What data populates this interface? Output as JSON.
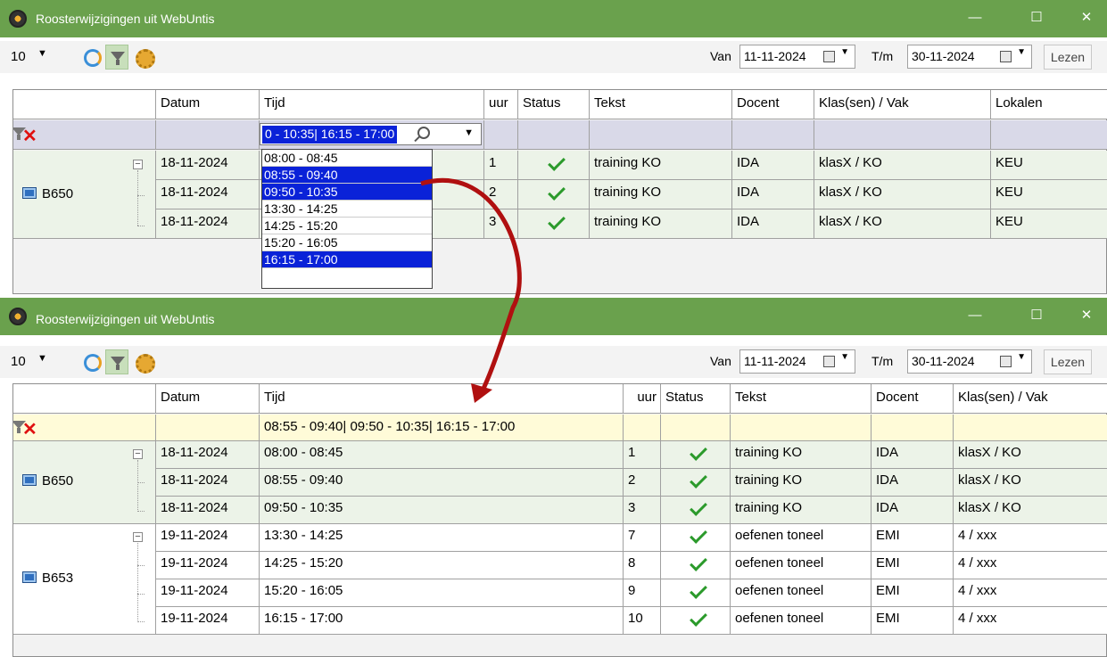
{
  "windows": [
    {
      "title": "Roosterwijzigingen uit WebUntis",
      "toolbar": {
        "count": "10",
        "van_label": "Van",
        "van_date": "11-11-2024",
        "tm_label": "T/m",
        "tm_date": "30-11-2024",
        "lezen": "Lezen"
      },
      "columns": [
        "Datum",
        "Tijd",
        "uur",
        "Status",
        "Tekst",
        "Docent",
        "Klas(sen) / Vak",
        "Lokalen"
      ],
      "filter_text": "0 - 10:35| 16:15 - 17:00",
      "dropdown_items": [
        {
          "label": "08:00 - 08:45",
          "selected": false
        },
        {
          "label": "08:55 - 09:40",
          "selected": true
        },
        {
          "label": "09:50 - 10:35",
          "selected": true
        },
        {
          "label": "13:30 - 14:25",
          "selected": false
        },
        {
          "label": "14:25 - 15:20",
          "selected": false
        },
        {
          "label": "15:20 - 16:05",
          "selected": false
        },
        {
          "label": "16:15 - 17:00",
          "selected": true
        }
      ],
      "group": "B650",
      "rows": [
        {
          "datum": "18-11-2024",
          "uur": "1",
          "tekst": "training KO",
          "docent": "IDA",
          "klas": "klasX / KO",
          "lokaal": "KEU"
        },
        {
          "datum": "18-11-2024",
          "uur": "2",
          "tekst": "training KO",
          "docent": "IDA",
          "klas": "klasX / KO",
          "lokaal": "KEU"
        },
        {
          "datum": "18-11-2024",
          "uur": "3",
          "tekst": "training KO",
          "docent": "IDA",
          "klas": "klasX / KO",
          "lokaal": "KEU"
        }
      ]
    },
    {
      "title": "Roosterwijzigingen uit WebUntis",
      "toolbar": {
        "count": "10",
        "van_label": "Van",
        "van_date": "11-11-2024",
        "tm_label": "T/m",
        "tm_date": "30-11-2024",
        "lezen": "Lezen"
      },
      "columns": [
        "Datum",
        "Tijd",
        "uur",
        "Status",
        "Tekst",
        "Docent",
        "Klas(sen) / Vak"
      ],
      "filter_text": "08:55 - 09:40| 09:50 - 10:35| 16:15 - 17:00",
      "groups": [
        {
          "name": "B650",
          "rows": [
            {
              "datum": "18-11-2024",
              "tijd": "08:00 - 08:45",
              "uur": "1",
              "tekst": "training KO",
              "docent": "IDA",
              "klas": "klasX / KO"
            },
            {
              "datum": "18-11-2024",
              "tijd": "08:55 - 09:40",
              "uur": "2",
              "tekst": "training KO",
              "docent": "IDA",
              "klas": "klasX / KO"
            },
            {
              "datum": "18-11-2024",
              "tijd": "09:50 - 10:35",
              "uur": "3",
              "tekst": "training KO",
              "docent": "IDA",
              "klas": "klasX / KO"
            }
          ]
        },
        {
          "name": "B653",
          "rows": [
            {
              "datum": "19-11-2024",
              "tijd": "13:30 - 14:25",
              "uur": "7",
              "tekst": "oefenen toneel",
              "docent": "EMI",
              "klas": "4 / xxx"
            },
            {
              "datum": "19-11-2024",
              "tijd": "14:25 - 15:20",
              "uur": "8",
              "tekst": "oefenen toneel",
              "docent": "EMI",
              "klas": "4 / xxx"
            },
            {
              "datum": "19-11-2024",
              "tijd": "15:20 - 16:05",
              "uur": "9",
              "tekst": "oefenen toneel",
              "docent": "EMI",
              "klas": "4 / xxx"
            },
            {
              "datum": "19-11-2024",
              "tijd": "16:15 - 17:00",
              "uur": "10",
              "tekst": "oefenen toneel",
              "docent": "EMI",
              "klas": "4 / xxx"
            }
          ]
        }
      ]
    }
  ],
  "colors": {
    "titlebar": "#6aa14d",
    "selection": "#0a22d8",
    "filter_row_active": "#fffbd8",
    "check": "#2b9a2b",
    "arrow": "#b01010"
  },
  "icons": {
    "status": "check-icon",
    "group": "calendar-icon",
    "filter_clear": "filter-clear-icon"
  }
}
